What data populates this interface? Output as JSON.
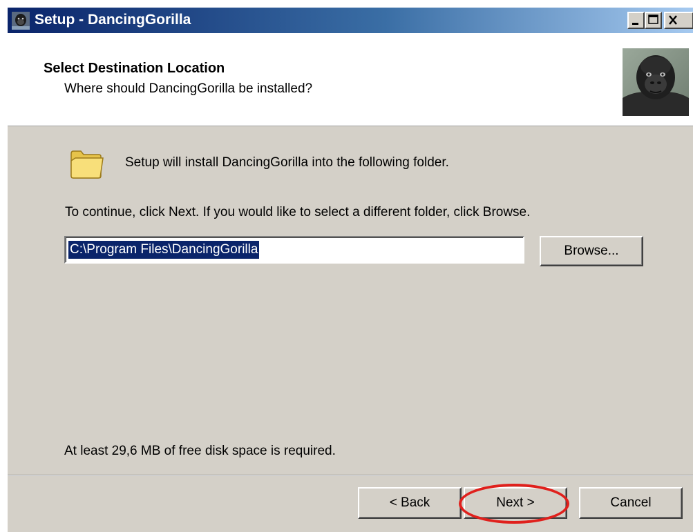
{
  "window": {
    "title": "Setup - DancingGorilla",
    "icon": "gorilla-app-icon",
    "controls": [
      "minimize-icon",
      "maximize-icon",
      "close-icon"
    ]
  },
  "header": {
    "title": "Select Destination Location",
    "subtitle": "Where should DancingGorilla be installed?",
    "image": "gorilla-photo"
  },
  "body": {
    "folder_icon": "folder-icon",
    "intro": "Setup will install DancingGorilla into the following folder.",
    "instructions": "To continue, click Next. If you would like to select a different folder, click Browse.",
    "path_value": "C:\\Program Files\\DancingGorilla",
    "browse_label": "Browse...",
    "disk_space": "At least 29,6 MB of free disk space is required."
  },
  "footer": {
    "back_label": "< Back",
    "next_label": "Next >",
    "cancel_label": "Cancel"
  },
  "colors": {
    "titlebar_start": "#0a246a",
    "titlebar_end": "#a6caf0",
    "dialog_face": "#d4d0c8",
    "selection": "#0a246a",
    "highlight_circle": "#e0201c"
  }
}
